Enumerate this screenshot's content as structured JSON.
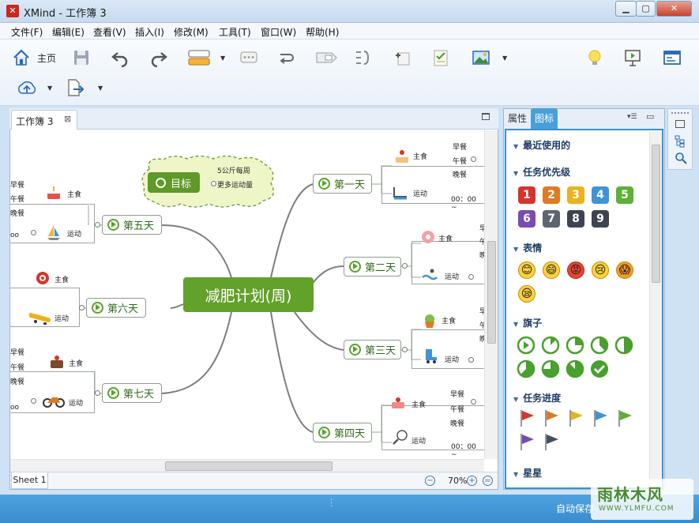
{
  "window": {
    "app": "XMind",
    "title": "XMind - 工作簿 3"
  },
  "menu": [
    "文件(F)",
    "编辑(E)",
    "查看(V)",
    "插入(I)",
    "修改(M)",
    "工具(T)",
    "窗口(W)",
    "帮助(H)"
  ],
  "toolbar": {
    "home_label": "主页",
    "icons": [
      "home-icon",
      "save-icon",
      "undo-icon",
      "redo-icon",
      "topic-icon",
      "callout-icon",
      "relationship-icon",
      "boundary-icon",
      "summary-icon",
      "marker-icon",
      "task-icon",
      "image-icon",
      "idea-icon",
      "presentation-icon",
      "layout-icon",
      "upload-icon",
      "export-icon"
    ]
  },
  "editor": {
    "tab_label": "工作簿 3",
    "sheet_tab": "Sheet 1",
    "zoom": "70%"
  },
  "map": {
    "central": "减肥计划(周)",
    "goal": {
      "label": "目标",
      "items": [
        "5公斤每周",
        "更多运动量"
      ]
    },
    "days": [
      {
        "id": "day1",
        "label": "第一天",
        "meal": "主食",
        "sport": "运动",
        "meals": [
          "早餐",
          "午餐",
          "晚餐"
        ],
        "time": "00：00 ~"
      },
      {
        "id": "day2",
        "label": "第二天",
        "meal": "主食",
        "sport": "运动",
        "meals": [
          "早",
          "午",
          "晚"
        ]
      },
      {
        "id": "day3",
        "label": "第三天",
        "meal": "主食",
        "sport": "运动",
        "meals": [
          "早",
          "午",
          "晚"
        ]
      },
      {
        "id": "day4",
        "label": "第四天",
        "meal": "主食",
        "sport": "运动",
        "meals": [
          "早餐",
          "午餐",
          "晚餐"
        ],
        "time": "00：00 ~"
      },
      {
        "id": "day5",
        "label": "第五天",
        "meal": "主食",
        "sport": "运动",
        "meals": [
          "早餐",
          "午餐",
          "晚餐"
        ],
        "time": "oo"
      },
      {
        "id": "day6",
        "label": "第六天",
        "meal": "主食",
        "sport": "运动"
      },
      {
        "id": "day7",
        "label": "第七天",
        "meal": "主食",
        "sport": "运动",
        "meals": [
          "早餐",
          "午餐",
          "晚餐"
        ],
        "time": "oo"
      }
    ]
  },
  "panel": {
    "tabs": [
      "属性",
      "图标"
    ],
    "active_tab": "图标",
    "sections": [
      "最近使用的",
      "任务优先级",
      "表情",
      "任务进度",
      "旗子",
      "星星"
    ],
    "priorities": [
      "1",
      "2",
      "3",
      "4",
      "5",
      "6",
      "7",
      "8",
      "9"
    ],
    "priority_colors": [
      "#d8332b",
      "#e07a22",
      "#e8b31f",
      "#3f94d8",
      "#5bb135",
      "#7a4bb0",
      "#5c6570",
      "#3c4450",
      "#3c4450"
    ],
    "faces": [
      "😊",
      "😄",
      "😡",
      "😢",
      "😱",
      "😪"
    ],
    "flag_colors": [
      "#d8332b",
      "#e07a22",
      "#e8b31f",
      "#3f94d8",
      "#5bb135",
      "#7a4bb0",
      "#44505e"
    ]
  },
  "status": {
    "autosave": "自动保存"
  },
  "watermark": {
    "title": "雨林木风",
    "url": "WWW.YLMFU.COM"
  }
}
